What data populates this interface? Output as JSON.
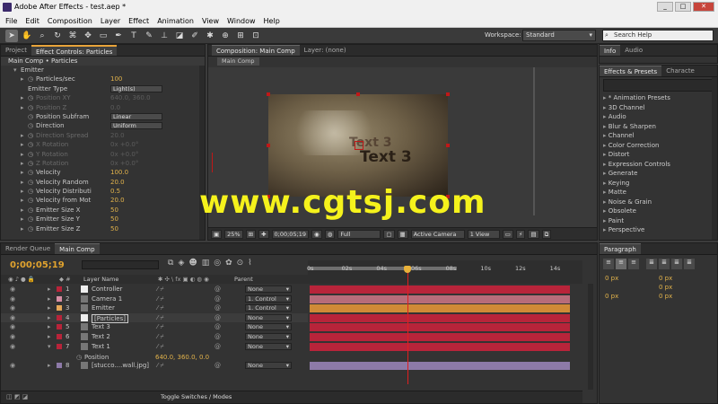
{
  "window": {
    "title": "Adobe After Effects - test.aep *",
    "controls": [
      "_",
      "□",
      "✕"
    ]
  },
  "menu": [
    "File",
    "Edit",
    "Composition",
    "Layer",
    "Effect",
    "Animation",
    "View",
    "Window",
    "Help"
  ],
  "toolbar": {
    "workspace_label": "Workspace:",
    "workspace_value": "Standard",
    "search_placeholder": "Search Help"
  },
  "effect_panel": {
    "tabs": [
      "Project",
      "Effect Controls: Particles"
    ],
    "header": "Main Comp • Particles",
    "group": "Emitter",
    "rows": [
      {
        "label": "Particles/sec",
        "value": "100",
        "dim": false
      },
      {
        "label": "Emitter Type",
        "value": "Light(s)",
        "type": "dropdown"
      },
      {
        "label": "Position XY",
        "value": "640.0, 360.0",
        "dim": true
      },
      {
        "label": "Position Z",
        "value": "0.0",
        "dim": true
      },
      {
        "label": "Position Subfram",
        "value": "Linear",
        "type": "dropdown"
      },
      {
        "label": "Direction",
        "value": "Uniform",
        "type": "dropdown"
      },
      {
        "label": "Direction Spread",
        "value": "20.0",
        "dim": true
      },
      {
        "label": "X Rotation",
        "value": "0x +0.0°",
        "dim": true
      },
      {
        "label": "Y Rotation",
        "value": "0x +0.0°",
        "dim": true
      },
      {
        "label": "Z Rotation",
        "value": "0x +0.0°",
        "dim": true
      },
      {
        "label": "Velocity",
        "value": "100.0",
        "dim": false
      },
      {
        "label": "Velocity Random",
        "value": "20.0",
        "dim": false
      },
      {
        "label": "Velocity Distributi",
        "value": "0.5",
        "dim": false
      },
      {
        "label": "Velocity from Mot",
        "value": "20.0",
        "dim": false
      },
      {
        "label": "Emitter Size X",
        "value": "50",
        "dim": false
      },
      {
        "label": "Emitter Size Y",
        "value": "50",
        "dim": false
      },
      {
        "label": "Emitter Size Z",
        "value": "50",
        "dim": false
      }
    ]
  },
  "comp_panel": {
    "tabs": [
      "Composition: Main Comp",
      "Layer: (none)"
    ],
    "subtab": "Main Comp",
    "canvas_text_top": "Text 3",
    "canvas_text_bottom": "Text 3",
    "watermark": "www.cgtsj.com",
    "viewer_bar": {
      "zoom": "25%",
      "timecode": "0;00;05;19",
      "resolution": "Full",
      "camera": "Active Camera",
      "views": "1 View"
    }
  },
  "info_panel": {
    "tabs": [
      "Info",
      "Audio"
    ]
  },
  "effects_presets": {
    "tabs": [
      "Effects & Presets",
      "Characte"
    ],
    "items": [
      "* Animation Presets",
      "3D Channel",
      "Audio",
      "Blur & Sharpen",
      "Channel",
      "Color Correction",
      "Distort",
      "Expression Controls",
      "Generate",
      "Keying",
      "Matte",
      "Noise & Grain",
      "Obsolete",
      "Paint",
      "Perspective"
    ]
  },
  "timeline": {
    "tabs": [
      "Render Queue",
      "Main Comp"
    ],
    "timecode": "0;00;05;19",
    "columns": {
      "layer_name": "Layer Name",
      "parent": "Parent"
    },
    "ruler": [
      "0s",
      "02s",
      "04s",
      "06s",
      "08s",
      "10s",
      "12s",
      "14s"
    ],
    "current_time_s": 5.65,
    "duration_s": 15,
    "layers": [
      {
        "num": "1",
        "name": "Controller",
        "parent": "None",
        "color": "#b8243a",
        "label_color": "#b8243a",
        "work": [
          0,
          15
        ],
        "type": "solid"
      },
      {
        "num": "2",
        "name": "Camera 1",
        "parent": "1. Control",
        "color": "#b76c7a",
        "label_color": "#d88ea4",
        "work": [
          0,
          15
        ],
        "type": "camera"
      },
      {
        "num": "3",
        "name": "Emitter",
        "parent": "1. Control",
        "color": "#d08a37",
        "label_color": "#e5a758",
        "work": [
          0,
          15
        ],
        "type": "light"
      },
      {
        "num": "4",
        "name": "[Particles]",
        "parent": "None",
        "color": "#b8243a",
        "label_color": "#b8243a",
        "work": [
          0,
          15
        ],
        "type": "solid"
      },
      {
        "num": "5",
        "name": "Text 3",
        "parent": "None",
        "color": "#b8243a",
        "label_color": "#b8243a",
        "work": [
          0,
          15
        ],
        "type": "text"
      },
      {
        "num": "6",
        "name": "Text 2",
        "parent": "None",
        "color": "#b8243a",
        "label_color": "#b8243a",
        "work": [
          0,
          15
        ],
        "type": "text"
      },
      {
        "num": "7",
        "name": "Text 1",
        "parent": "None",
        "color": "#b8243a",
        "label_color": "#b8243a",
        "work": [
          0,
          15
        ],
        "type": "text"
      },
      {
        "num": "8",
        "name": "[stucco....wall.jpg]",
        "parent": "None",
        "color": "#8d7aa8",
        "label_color": "#8d7aa8",
        "work": [
          0,
          15
        ],
        "type": "footage"
      }
    ],
    "position_prop": {
      "label": "Position",
      "value": "640.0, 360.0, 0.0"
    },
    "footer_label": "Toggle Switches / Modes"
  },
  "paragraph_panel": {
    "tab": "Paragraph",
    "fields": [
      "0 px",
      "0 px",
      "0 px",
      "0 px",
      "0 px"
    ]
  }
}
